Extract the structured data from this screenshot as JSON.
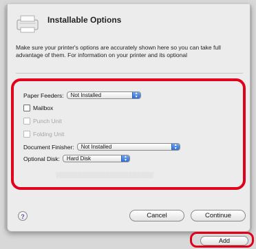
{
  "dialog": {
    "title": "Installable Options",
    "description": "Make sure your printer's options are accurately shown here so you can take full advantage of them.  For information on your printer and its optional"
  },
  "options": {
    "paper_feeders": {
      "label": "Paper Feeders:",
      "value": "Not Installed"
    },
    "mailbox": {
      "label": "Mailbox",
      "checked": false
    },
    "punch_unit": {
      "label": "Punch Unit",
      "checked": false,
      "enabled": false
    },
    "folding_unit": {
      "label": "Folding Unit",
      "checked": false,
      "enabled": false
    },
    "document_finisher": {
      "label": "Document Finisher:",
      "value": "Not Installed"
    },
    "optional_disk": {
      "label": "Optional Disk:",
      "value": "Hard Disk"
    }
  },
  "buttons": {
    "help": "?",
    "cancel": "Cancel",
    "continue": "Continue",
    "add": "Add"
  },
  "colors": {
    "highlight": "#e1001b",
    "popup_arrow": "#2f6ed4"
  }
}
